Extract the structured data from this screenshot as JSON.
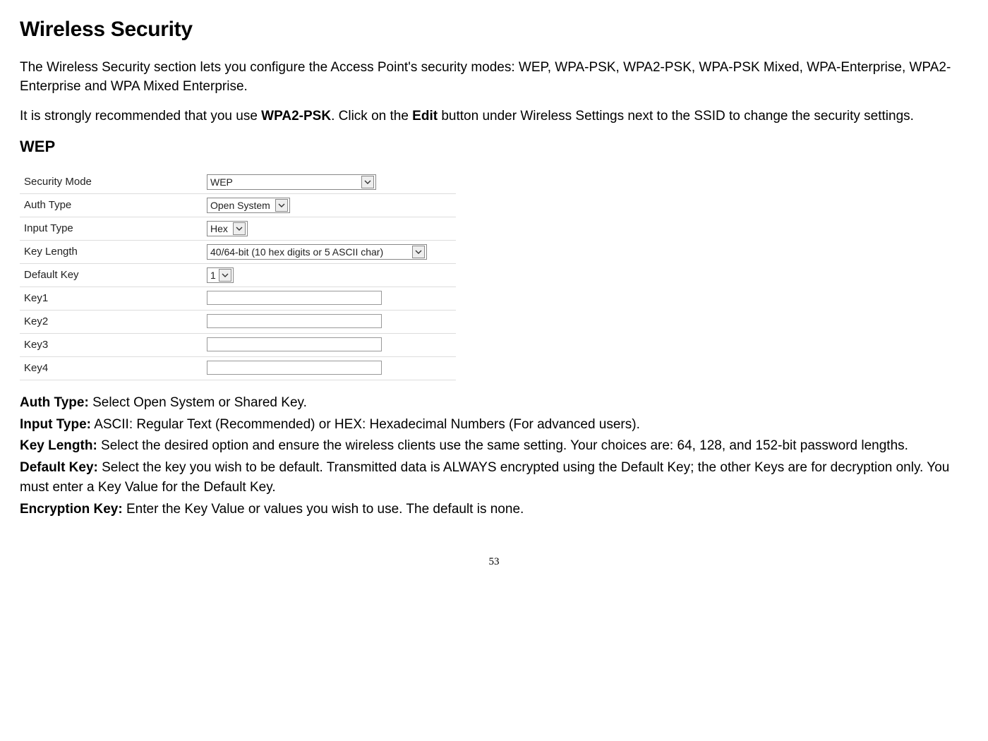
{
  "title": "Wireless Security",
  "intro1": "The Wireless Security section lets you configure the Access Point's security modes: WEP, WPA-PSK, WPA2-PSK, WPA-PSK Mixed, WPA-Enterprise, WPA2-Enterprise and WPA Mixed Enterprise.",
  "intro2_pre": "It is strongly recommended that you use ",
  "intro2_b1": "WPA2-PSK",
  "intro2_mid": ". Click on the ",
  "intro2_b2": "Edit",
  "intro2_post": " button under Wireless Settings next to the SSID to change the security settings.",
  "wep_heading": "WEP",
  "table": {
    "security_mode": {
      "label": "Security Mode",
      "value": "WEP"
    },
    "auth_type": {
      "label": "Auth Type",
      "value": "Open System"
    },
    "input_type": {
      "label": "Input Type",
      "value": "Hex"
    },
    "key_length": {
      "label": "Key Length",
      "value": "40/64-bit (10 hex digits or 5 ASCII char)"
    },
    "default_key": {
      "label": "Default Key",
      "value": "1"
    },
    "key1": {
      "label": "Key1",
      "value": ""
    },
    "key2": {
      "label": "Key2",
      "value": ""
    },
    "key3": {
      "label": "Key3",
      "value": ""
    },
    "key4": {
      "label": "Key4",
      "value": ""
    }
  },
  "defs": {
    "auth_type": {
      "term": "Auth Type:",
      "text": " Select Open System or Shared Key."
    },
    "input_type": {
      "term": "Input Type:",
      "text": " ASCII: Regular Text (Recommended) or HEX: Hexadecimal Numbers (For advanced users)."
    },
    "key_length": {
      "term": "Key Length:",
      "text": " Select the desired option and ensure the wireless clients use the same setting. Your choices are: 64, 128, and 152-bit password lengths."
    },
    "default_key": {
      "term": "Default Key:",
      "text": " Select the key you wish to be default. Transmitted data is ALWAYS encrypted using the Default Key; the other Keys are for decryption only. You must enter a Key Value for the Default Key."
    },
    "enc_key": {
      "term": "Encryption Key:",
      "text": " Enter the Key Value or values you wish to use. The default is none."
    }
  },
  "page_number": "53"
}
